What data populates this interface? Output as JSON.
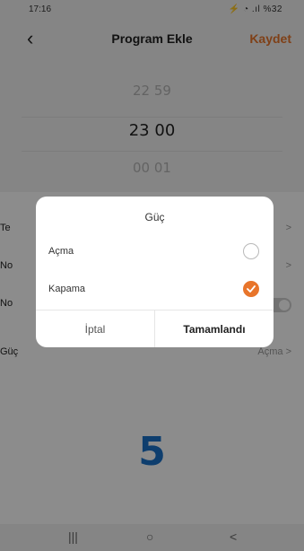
{
  "status": {
    "time": "17:16",
    "icons": "⚡ ◔ .ıl %32",
    "battery": "%32"
  },
  "navbar": {
    "back_icon": "chevron-left-icon",
    "title": "Program Ekle",
    "save_label": "Kaydet"
  },
  "time_picker": {
    "above": "22  59",
    "selected": "23  00",
    "below": "00  01"
  },
  "settings_rows": [
    {
      "label": "Te",
      "value": ">"
    },
    {
      "label": "No",
      "value": ">"
    },
    {
      "label": "No",
      "value": ""
    },
    {
      "label": "Güç",
      "value": "Açma >"
    }
  ],
  "step_number": "5",
  "dialog": {
    "title": "Güç",
    "options": [
      {
        "label": "Açma",
        "selected": false
      },
      {
        "label": "Kapama",
        "selected": true
      }
    ],
    "cancel_label": "İptal",
    "done_label": "Tamamlandı"
  },
  "system_nav": {
    "recent": "|||",
    "home": "○",
    "back": "<"
  },
  "colors": {
    "accent": "#e8752b",
    "step_blue": "#1a72c9"
  }
}
